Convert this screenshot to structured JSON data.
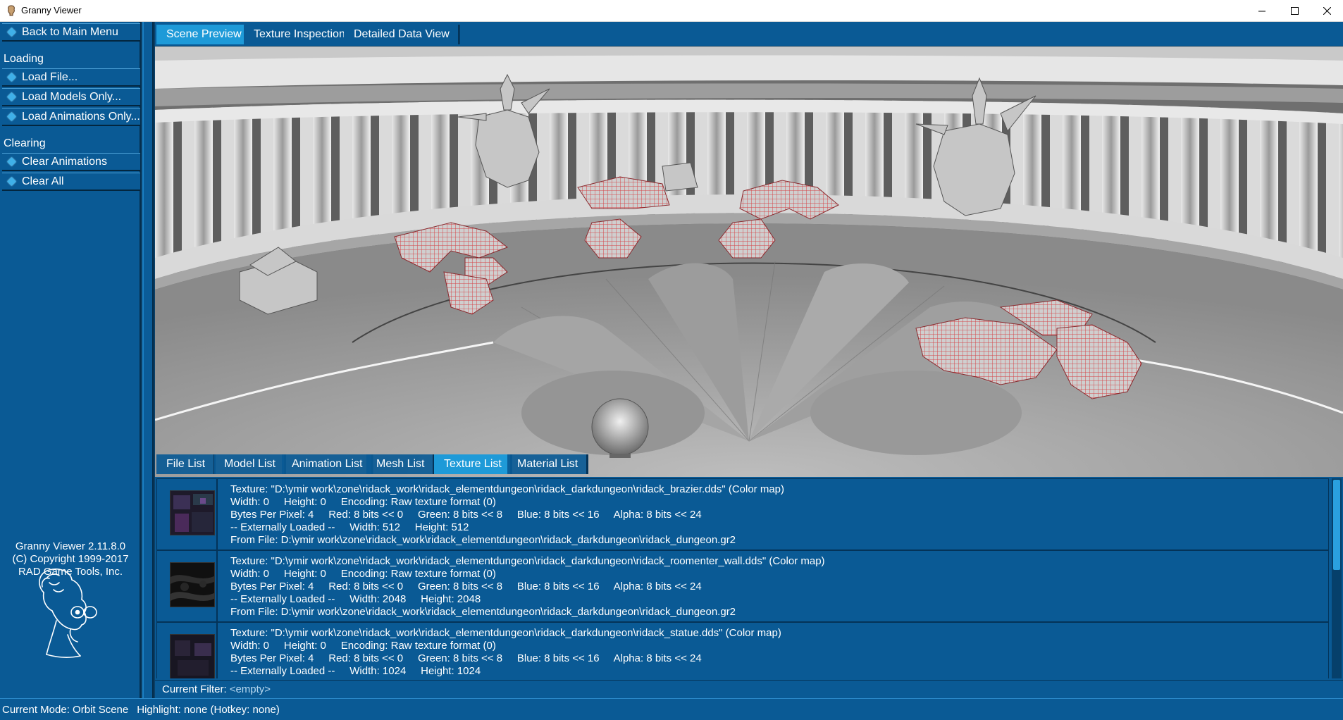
{
  "window": {
    "title": "Granny Viewer"
  },
  "sidebar": {
    "back_button": "Back to Main Menu",
    "loading_section": "Loading",
    "loading_items": [
      "Load File...",
      "Load Models Only...",
      "Load Animations Only..."
    ],
    "clearing_section": "Clearing",
    "clearing_items": [
      "Clear Animations",
      "Clear All"
    ],
    "about": {
      "version": "Granny Viewer 2.11.8.0",
      "copyright": "(C) Copyright 1999-2017",
      "company": "RAD Game Tools, Inc."
    }
  },
  "top_tabs": [
    {
      "label": "Scene Preview",
      "active": true
    },
    {
      "label": "Texture Inspection",
      "active": false
    },
    {
      "label": "Detailed Data View",
      "active": false
    }
  ],
  "bottom_tabs": [
    {
      "label": "File List",
      "active": false
    },
    {
      "label": "Model List",
      "active": false
    },
    {
      "label": "Animation List",
      "active": false
    },
    {
      "label": "Mesh List",
      "active": false
    },
    {
      "label": "Texture List",
      "active": true
    },
    {
      "label": "Material List",
      "active": false
    }
  ],
  "textures": [
    {
      "line1": "Texture: \"D:\\ymir work\\zone\\ridack_work\\ridack_elementdungeon\\ridack_darkdungeon\\ridack_brazier.dds\" (Color map)",
      "line2": "Width: 0     Height: 0     Encoding: Raw texture format (0)",
      "line3": "Bytes Per Pixel: 4     Red: 8 bits << 0     Green: 8 bits << 8     Blue: 8 bits << 16     Alpha: 8 bits << 24",
      "line4": "-- Externally Loaded --     Width: 512     Height: 512",
      "line5": "From File: D:\\ymir work\\zone\\ridack_work\\ridack_elementdungeon\\ridack_darkdungeon\\ridack_dungeon.gr2"
    },
    {
      "line1": "Texture: \"D:\\ymir work\\zone\\ridack_work\\ridack_elementdungeon\\ridack_darkdungeon\\ridack_roomenter_wall.dds\" (Color map)",
      "line2": "Width: 0     Height: 0     Encoding: Raw texture format (0)",
      "line3": "Bytes Per Pixel: 4     Red: 8 bits << 0     Green: 8 bits << 8     Blue: 8 bits << 16     Alpha: 8 bits << 24",
      "line4": "-- Externally Loaded --     Width: 2048     Height: 2048",
      "line5": "From File: D:\\ymir work\\zone\\ridack_work\\ridack_elementdungeon\\ridack_darkdungeon\\ridack_dungeon.gr2"
    },
    {
      "line1": "Texture: \"D:\\ymir work\\zone\\ridack_work\\ridack_elementdungeon\\ridack_darkdungeon\\ridack_statue.dds\" (Color map)",
      "line2": "Width: 0     Height: 0     Encoding: Raw texture format (0)",
      "line3": "Bytes Per Pixel: 4     Red: 8 bits << 0     Green: 8 bits << 8     Blue: 8 bits << 16     Alpha: 8 bits << 24",
      "line4": "-- Externally Loaded --     Width: 1024     Height: 1024",
      "line5": ""
    }
  ],
  "filter": {
    "label": "Current Filter:",
    "value": "<empty>"
  },
  "status": {
    "mode": "Current Mode: Orbit Scene",
    "highlight": "Highlight: none (Hotkey: none)"
  },
  "colors": {
    "panel": "#0a5a95",
    "active_tab": "#1e9ad8",
    "highlight_red": "#d4454a"
  },
  "icons": [
    "app-icon",
    "minimize-icon",
    "maximize-icon",
    "close-icon",
    "diamond-bullet-icon",
    "granny-mascot-icon"
  ]
}
